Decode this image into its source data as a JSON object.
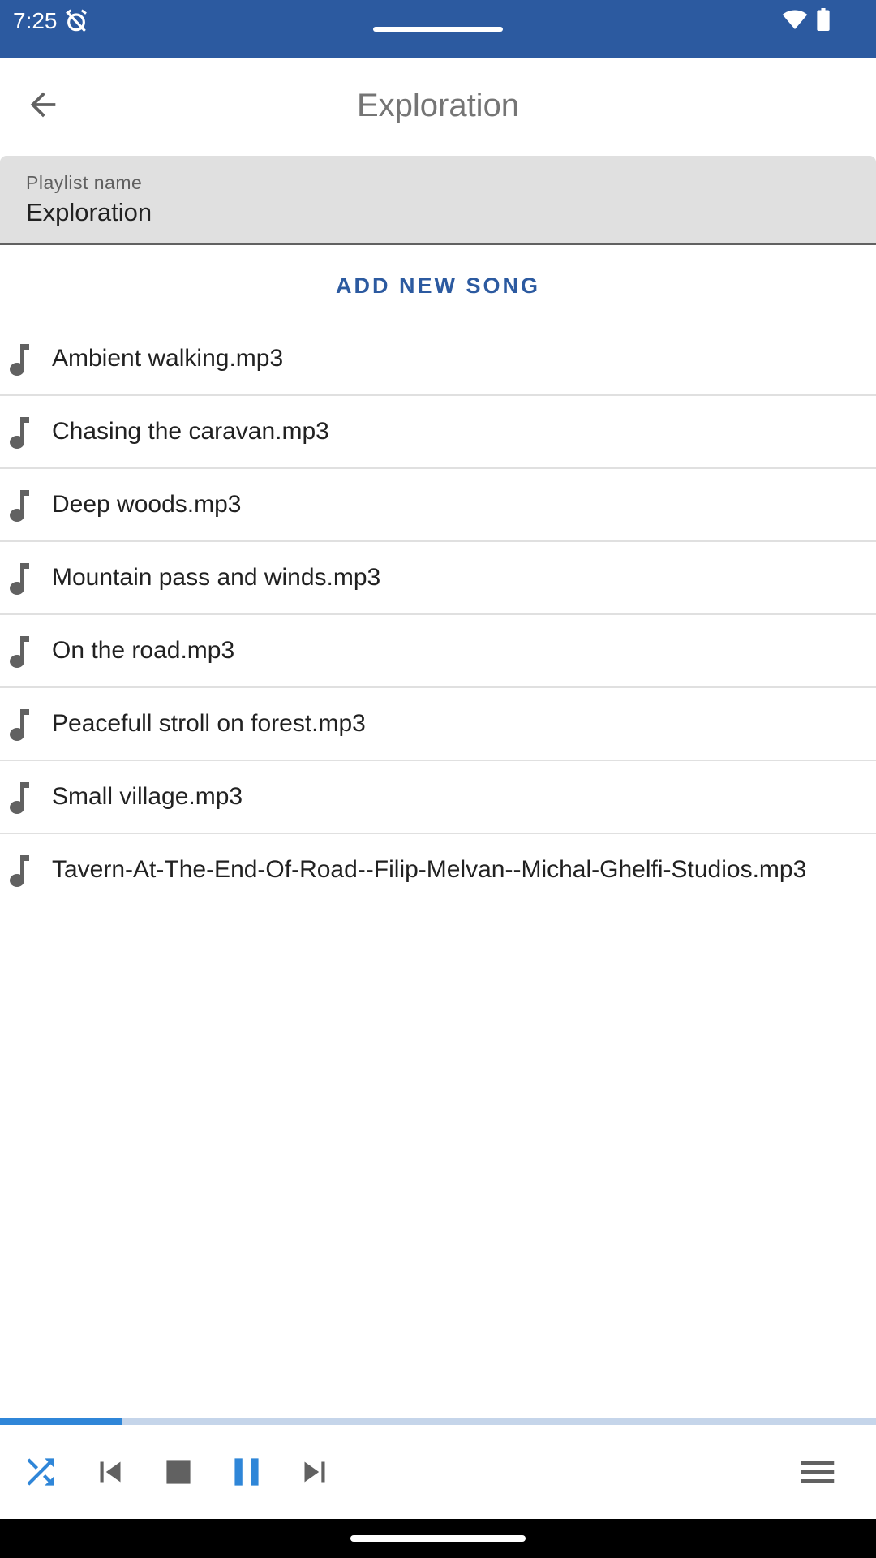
{
  "status_bar": {
    "time": "7:25",
    "icons": [
      "alarm-off-icon",
      "wifi-icon",
      "battery-icon"
    ],
    "color": "#2c5aa0"
  },
  "app_bar": {
    "title": "Exploration",
    "back_icon": "arrow-back-icon"
  },
  "playlist_field": {
    "label": "Playlist name",
    "value": "Exploration"
  },
  "add_song_button": "ADD NEW SONG",
  "songs": [
    "Ambient walking.mp3",
    "Chasing the caravan.mp3",
    "Deep woods.mp3",
    "Mountain pass and winds.mp3",
    "On the road.mp3",
    "Peacefull stroll on forest.mp3",
    "Small village.mp3",
    "Tavern-At-The-End-Of-Road--Filip-Melvan--Michal-Ghelfi-Studios.mp3"
  ],
  "player": {
    "progress_fraction": 0.14,
    "controls": [
      "shuffle-icon",
      "skip-previous-icon",
      "stop-icon",
      "pause-icon",
      "skip-next-icon",
      "menu-icon"
    ],
    "accent_color": "#2f86d8"
  }
}
